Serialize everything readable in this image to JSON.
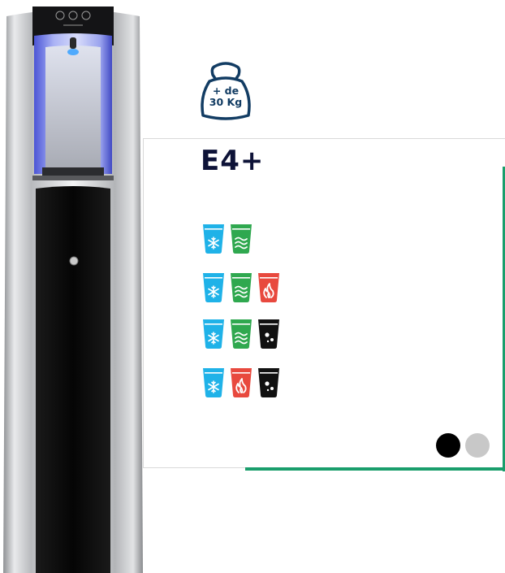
{
  "product": {
    "model": "E4+",
    "weight_line1": "+ de",
    "weight_line2": "30 Kg"
  },
  "variants": [
    [
      "cold",
      "ambient"
    ],
    [
      "cold",
      "ambient",
      "hot"
    ],
    [
      "cold",
      "ambient",
      "sparkling"
    ],
    [
      "cold",
      "hot",
      "sparkling"
    ]
  ],
  "water_types": {
    "cold": {
      "icon": "snowflake-icon",
      "color": "#1fb2e8"
    },
    "ambient": {
      "icon": "wave-icon",
      "color": "#2fa84f"
    },
    "hot": {
      "icon": "flame-icon",
      "color": "#e8493e"
    },
    "sparkling": {
      "icon": "bubbles-icon",
      "color": "#111111"
    }
  },
  "color_options": [
    {
      "name": "black",
      "color": "#000000"
    },
    {
      "name": "silver",
      "color": "#c8c8c8"
    }
  ],
  "accent_color": "#1a9e6c"
}
